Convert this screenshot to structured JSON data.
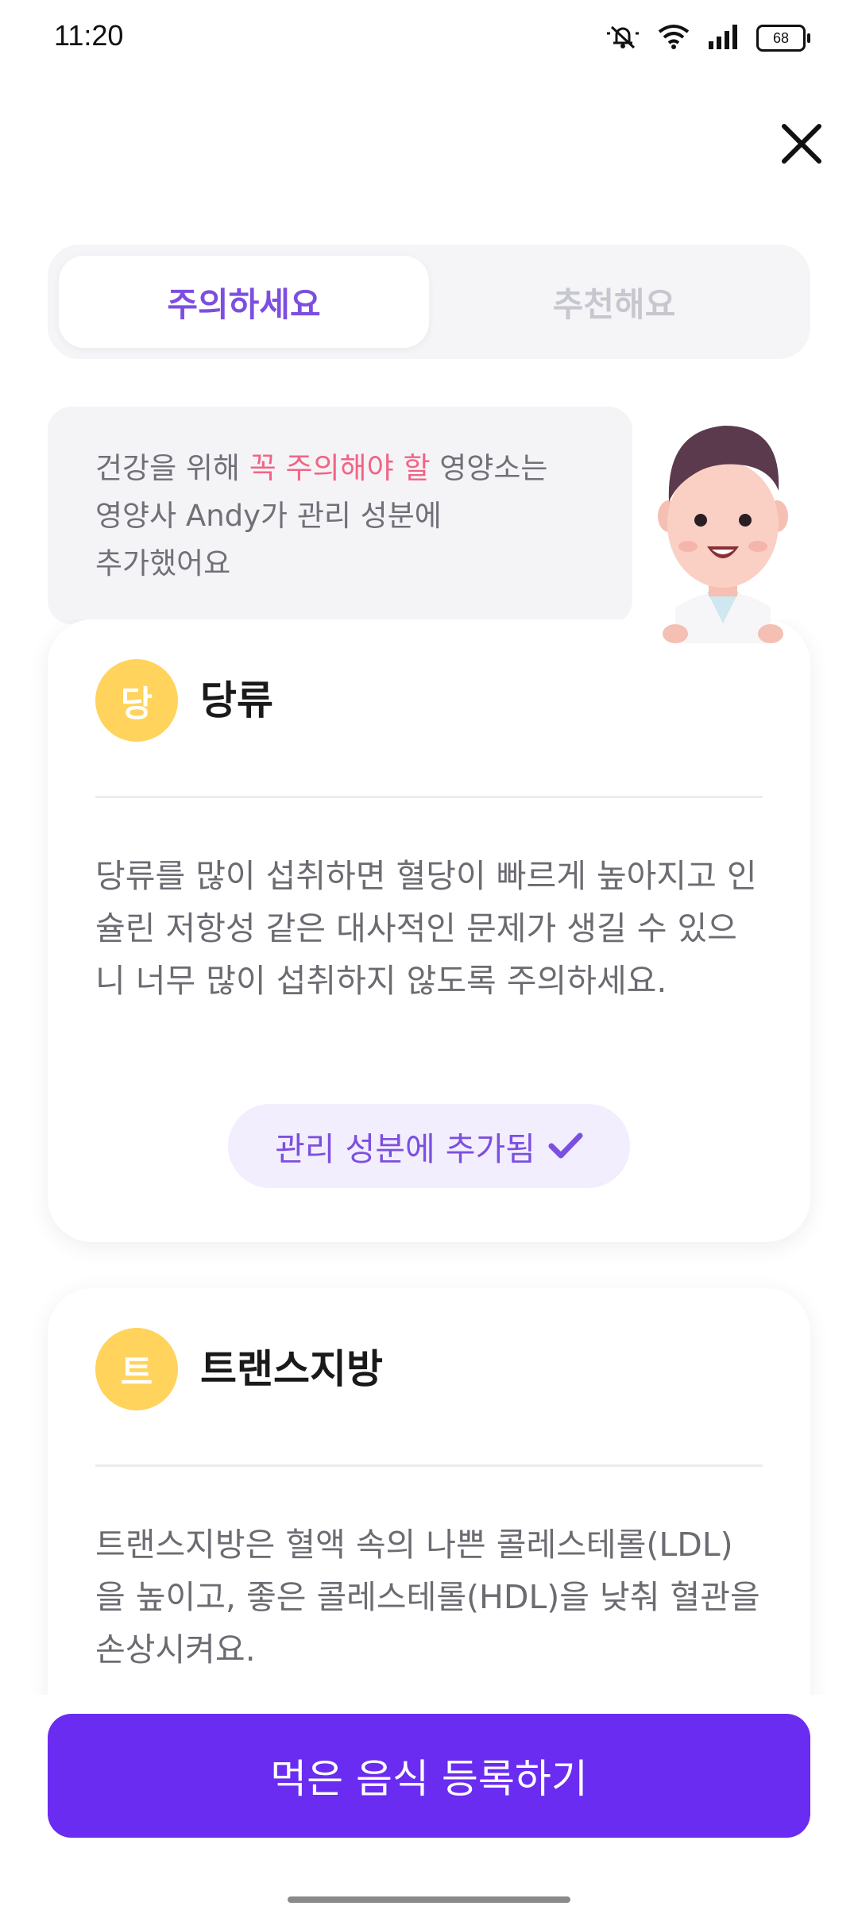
{
  "status_bar": {
    "time": "11:20",
    "battery": "68",
    "icons": [
      "mute-icon",
      "wifi-icon",
      "signal-icon",
      "battery-icon"
    ]
  },
  "header": {
    "close_icon": "close-icon"
  },
  "tabs": [
    {
      "label": "주의하세요",
      "active": true
    },
    {
      "label": "추천해요",
      "active": false
    }
  ],
  "intro": {
    "prefix": "건강을 위해 ",
    "highlight": "꼭 주의해야 할",
    "suffix": " 영양소는",
    "line2": "영양사 Andy가 관리 성분에",
    "line3": "추가했어요"
  },
  "cards": [
    {
      "badge": "당",
      "title": "당류",
      "description": "당류를 많이 섭취하면 혈당이 빠르게 높아지고 인슐린 저항성 같은 대사적인 문제가 생길 수 있으니 너무 많이 섭취하지 않도록 주의하세요.",
      "action_label": "관리 성분에 추가됨"
    },
    {
      "badge": "트",
      "title": "트랜스지방",
      "description": "트랜스지방은 혈액 속의 나쁜 콜레스테롤(LDL)을 높이고, 좋은 콜레스테롤(HDL)을 낮춰 혈관을 손상시켜요."
    }
  ],
  "cta": {
    "label": "먹은 음식 등록하기"
  },
  "colors": {
    "accent": "#7c4fe0",
    "cta": "#6a2cf0",
    "highlight": "#f26485",
    "badge": "#ffd35c"
  }
}
